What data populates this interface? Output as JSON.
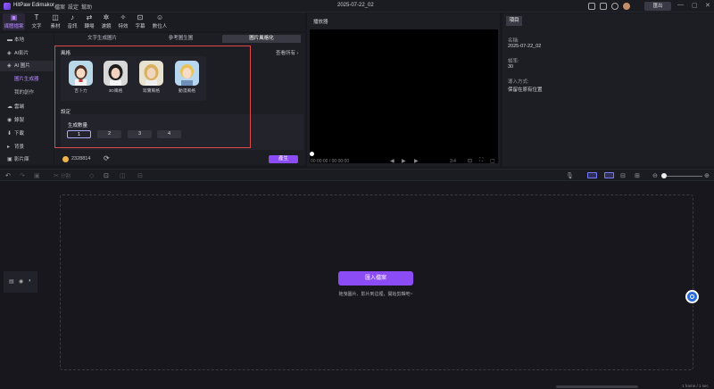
{
  "app": {
    "name": "HitPaw Edimakor",
    "menu": [
      "檔案",
      "設定",
      "幫助"
    ],
    "project_title": "2025-07-22_02",
    "export_label": "匯出"
  },
  "toolbar": {
    "tools": [
      {
        "label": "媒體檔案",
        "icon": "media-icon",
        "active": true
      },
      {
        "label": "文字",
        "icon": "text-icon"
      },
      {
        "label": "素材",
        "icon": "sticker-icon"
      },
      {
        "label": "音訊",
        "icon": "audio-icon"
      },
      {
        "label": "轉場",
        "icon": "transition-icon"
      },
      {
        "label": "濾鏡",
        "icon": "filter-icon"
      },
      {
        "label": "特效",
        "icon": "effect-icon"
      },
      {
        "label": "字幕",
        "icon": "subtitle-icon"
      },
      {
        "label": "數位人",
        "icon": "avatar-icon"
      }
    ]
  },
  "sidebar": {
    "items": [
      {
        "label": "本地"
      },
      {
        "label": "AI影片"
      },
      {
        "label": "AI 圖片"
      },
      {
        "label": "圖片生成器"
      },
      {
        "label": "我的創作"
      },
      {
        "label": "雲端"
      },
      {
        "label": "錄製"
      },
      {
        "label": "下載"
      },
      {
        "label": "背景"
      },
      {
        "label": "影片庫"
      }
    ]
  },
  "media": {
    "tabs": [
      "文字生成圖片",
      "參考圖生圖",
      "圖片風格化"
    ],
    "view_all": "查看所有",
    "style_label": "風格",
    "styles": [
      {
        "label": "吉卜力"
      },
      {
        "label": "3D風格"
      },
      {
        "label": "寫實風格"
      },
      {
        "label": "動漫風格"
      }
    ],
    "settings_label": "設定",
    "count_label": "生成數量",
    "counts": [
      "1",
      "2",
      "3",
      "4"
    ],
    "selected_count": "1",
    "credits": "2328814",
    "generate_label": "產生"
  },
  "player": {
    "title": "播放器",
    "timecode": "00:00:00 / 00:00:00",
    "ratio": "3:4"
  },
  "properties": {
    "tab": "項目",
    "name_label": "名稱:",
    "name_value": "2025-07-22_02",
    "fps_label": "幀率:",
    "fps_value": "30",
    "import_mode_label": "導入方式:",
    "import_mode_value": "保留在原有位置"
  },
  "timeline": {
    "split_label": "分割",
    "import_label": "匯入檔案",
    "drag_hint": "拖曳圖片、影片到這裡，開始剪輯吧~",
    "zoom_readout": "1 frame / 1 sec"
  },
  "colors": {
    "accent": "#8c4cf5",
    "highlight_outline": "#e04a4a"
  }
}
